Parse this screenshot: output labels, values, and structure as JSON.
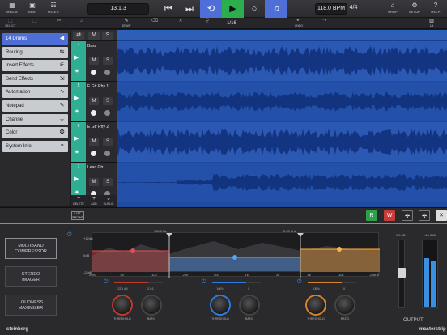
{
  "topbar": {
    "left_buttons": [
      {
        "icon": "media-icon",
        "glyph": "▦",
        "label": "MEDIA"
      },
      {
        "icon": "inspector-icon",
        "glyph": "▣",
        "label": "INSP"
      },
      {
        "icon": "mixer-icon",
        "glyph": "☷",
        "label": "MIXER"
      }
    ],
    "position": "13.1.3",
    "tempo": "118.0 BPM",
    "signature": "4/4",
    "right_buttons": [
      {
        "icon": "shop-icon",
        "glyph": "⌂",
        "label": "SHOP"
      },
      {
        "icon": "setup-icon",
        "glyph": "⚙",
        "label": "SETUP"
      },
      {
        "icon": "help-icon",
        "glyph": "?",
        "label": "HELP"
      }
    ],
    "accent_cycle": "#4e6fd8",
    "accent_play": "#2cae4f"
  },
  "tools": {
    "items": [
      {
        "icon": "select-icon",
        "glyph": "⬚",
        "label": "SELECT"
      },
      {
        "icon": "range-icon",
        "glyph": "⬚",
        "label": ""
      },
      {
        "icon": "split-icon",
        "glyph": "✂",
        "label": ""
      },
      {
        "icon": "glue-icon",
        "glyph": "⎍",
        "label": ""
      },
      {
        "icon": "draw-icon",
        "glyph": "✎",
        "label": "DRAW"
      },
      {
        "icon": "erase-icon",
        "glyph": "⌫",
        "label": ""
      },
      {
        "icon": "mute-tool-icon",
        "glyph": "✕",
        "label": ""
      },
      {
        "icon": "zoom-icon",
        "glyph": "⚲",
        "label": ""
      }
    ],
    "quantize": "1/16",
    "undo_label": "UNDO",
    "redo_label": "",
    "grid_label": "1/4"
  },
  "inspector": {
    "items": [
      {
        "label": "14 Drums",
        "icon": "arrow-left-icon",
        "glyph": "◀",
        "active": true
      },
      {
        "label": "Routing",
        "icon": "routing-icon",
        "glyph": "⇆",
        "active": false
      },
      {
        "label": "Insert Effects",
        "icon": "insert-effects-icon",
        "glyph": "⚟",
        "active": false
      },
      {
        "label": "Send Effects",
        "icon": "send-effects-icon",
        "glyph": "⇲",
        "active": false
      },
      {
        "label": "Automation",
        "icon": "automation-icon",
        "glyph": "∿",
        "active": false
      },
      {
        "label": "Notepad",
        "icon": "notepad-icon",
        "glyph": "✎",
        "active": false
      },
      {
        "label": "Channel",
        "icon": "channel-icon",
        "glyph": "⏚",
        "active": false
      },
      {
        "label": "Color",
        "icon": "color-icon",
        "glyph": "❂",
        "active": false
      },
      {
        "label": "System Info",
        "icon": "system-info-icon",
        "glyph": "≡",
        "active": false
      }
    ]
  },
  "tracks": {
    "header_buttons": {
      "m": "M",
      "s": "S"
    },
    "items": [
      {
        "num": "4",
        "name": "Bass",
        "color": "#2fae93"
      },
      {
        "num": "5",
        "name": "E Gtr Rhy 1",
        "color": "#2fae93"
      },
      {
        "num": "6",
        "name": "E Gtr Rhy 2",
        "color": "#2fae93"
      },
      {
        "num": "7",
        "name": "Lead Gtr",
        "color": "#2fae93"
      }
    ],
    "footer": [
      {
        "icon": "delete-icon",
        "glyph": "−",
        "label": "DELETE"
      },
      {
        "icon": "add-icon",
        "glyph": "+",
        "label": "ADD"
      },
      {
        "icon": "duplicate-icon",
        "glyph": "⌄",
        "label": "DUPLIC"
      }
    ],
    "list_browse": "LIST\nBROWS"
  },
  "panelbar": {
    "buttons": [
      {
        "label": "R",
        "color": "#2e9f4a"
      },
      {
        "label": "W",
        "color": "#c93a3a"
      },
      {
        "label": "✣",
        "color": "#3a3a40"
      },
      {
        "label": "✣",
        "color": "#3a3a40"
      }
    ],
    "close": "✕"
  },
  "mastering": {
    "modules": [
      {
        "label": "MULTIBAND\nCOMPRESSOR",
        "active": true
      },
      {
        "label": "STEREO\nIMAGER",
        "active": false
      },
      {
        "label": "LOUDNESS\nMAXIMIZER",
        "active": false
      }
    ],
    "eq": {
      "top_left": "+12dB",
      "mid_left": "0dB",
      "bottom_left": "-24dB",
      "band_split_1": "180.0 Hz",
      "band_split_2": "2.20 kHz",
      "freq_ticks": [
        "20Hz",
        "50",
        "100",
        "200",
        "500",
        "1k",
        "2k",
        "5k",
        "10k",
        "20kHz"
      ]
    },
    "bands": [
      {
        "color": "#c0392b",
        "threshold_val": "-23.1 dB",
        "ratio_val": "2.0:1"
      },
      {
        "color": "#2f7de0",
        "threshold_val": "100%",
        "ratio_val": "0"
      },
      {
        "color": "#d9822b",
        "threshold_val": "100%",
        "ratio_val": "0"
      }
    ],
    "threshold_label": "THRESHOLD",
    "ratio_label": "RATIO",
    "output_label": "OUTPUT",
    "output_left": "0.0 dB",
    "output_right": "-16.3dB",
    "brand": "steinberg",
    "product": "masterstrip"
  }
}
